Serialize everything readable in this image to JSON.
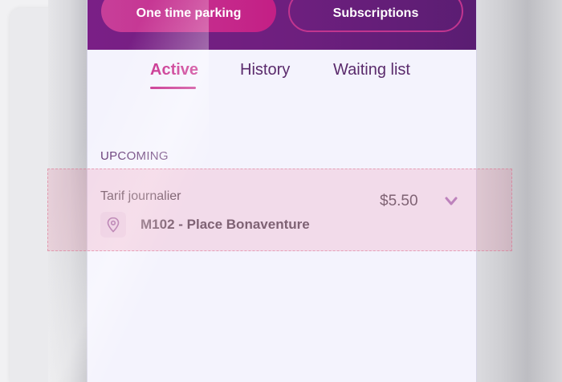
{
  "header": {
    "one_time_label": "One time parking",
    "subscriptions_label": "Subscriptions"
  },
  "tabs": [
    {
      "label": "Active",
      "active": true
    },
    {
      "label": "History",
      "active": false
    },
    {
      "label": "Waiting list",
      "active": false
    }
  ],
  "section": {
    "label": "UPCOMING"
  },
  "booking": {
    "title": "Tarif journalier",
    "price": "$5.50",
    "location": "M102 - Place Bonaventure",
    "location_icon": "map-pin-icon",
    "expand_icon": "chevron-down-icon"
  },
  "colors": {
    "brand_purple": "#6d1f7e",
    "accent_pink": "#c41f85",
    "highlight": "#ec6088"
  }
}
